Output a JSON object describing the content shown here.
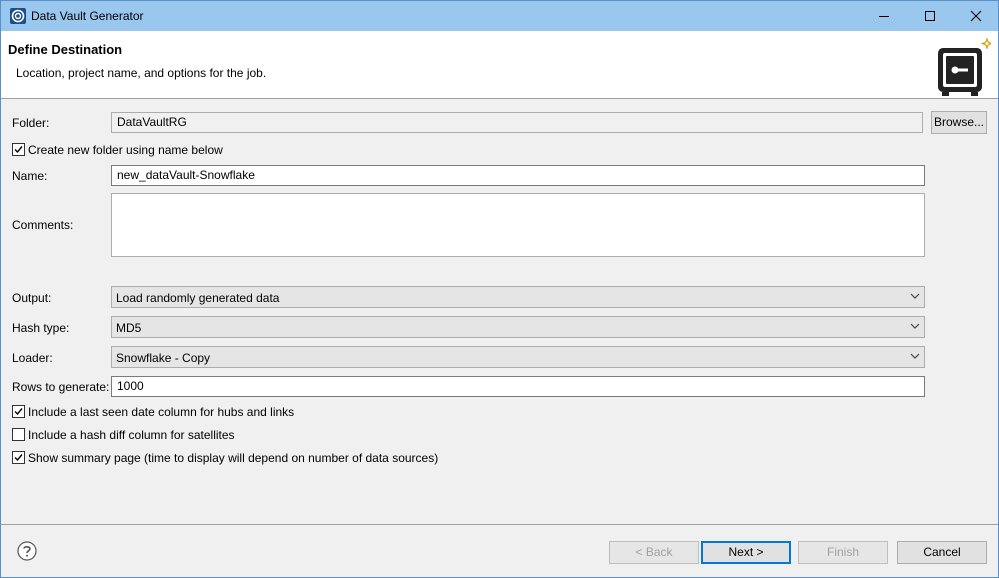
{
  "window": {
    "title": "Data Vault Generator",
    "icons": {
      "app": "app-logo-icon",
      "minimize": "minimize-icon",
      "maximize": "maximize-icon",
      "close": "close-icon"
    }
  },
  "header": {
    "title": "Define Destination",
    "description": "Location, project name, and options for the job.",
    "icon": "vault-safe-icon"
  },
  "form": {
    "folder": {
      "label": "Folder:",
      "value": "DataVaultRG",
      "browse": "Browse..."
    },
    "create_folder": {
      "label": "Create new folder using name below",
      "checked": true
    },
    "name": {
      "label": "Name:",
      "value": "new_dataVault-Snowflake"
    },
    "comments": {
      "label": "Comments:",
      "value": ""
    },
    "output": {
      "label": "Output:",
      "value": "Load randomly generated data"
    },
    "hash_type": {
      "label": "Hash type:",
      "value": "MD5"
    },
    "loader": {
      "label": "Loader:",
      "value": "Snowflake - Copy"
    },
    "rows": {
      "label": "Rows to generate:",
      "value": "1000"
    },
    "last_seen": {
      "label": "Include a last seen date column for hubs and links",
      "checked": true
    },
    "hash_diff": {
      "label": "Include a hash diff column for satellites",
      "checked": false
    },
    "summary": {
      "label": "Show summary page (time to display will depend on number of data sources)",
      "checked": true
    }
  },
  "footer": {
    "help_icon": "help-icon",
    "back": "< Back",
    "next": "Next >",
    "finish": "Finish",
    "cancel": "Cancel"
  }
}
